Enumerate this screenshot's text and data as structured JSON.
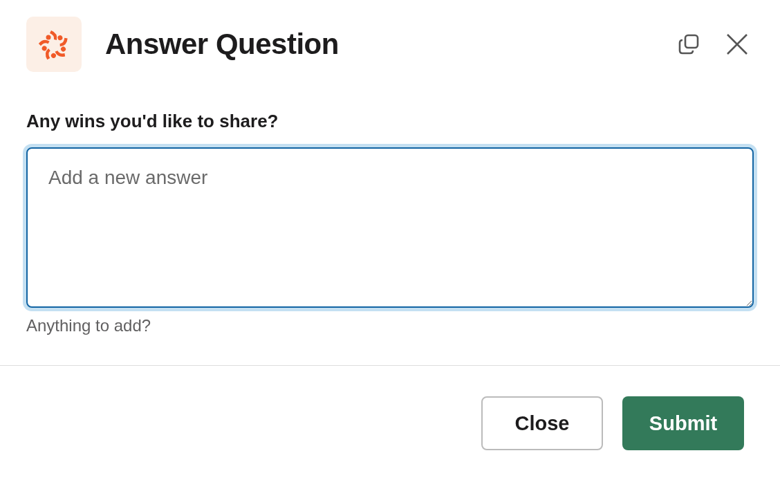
{
  "dialog": {
    "title": "Answer Question"
  },
  "question": {
    "label": "Any wins you'd like to share?",
    "placeholder": "Add a new answer",
    "focused": true,
    "hint": "Anything to add?"
  },
  "buttons": [
    {
      "label": "Close",
      "kind": "secondary"
    },
    {
      "label": "Submit",
      "kind": "primary"
    }
  ]
}
